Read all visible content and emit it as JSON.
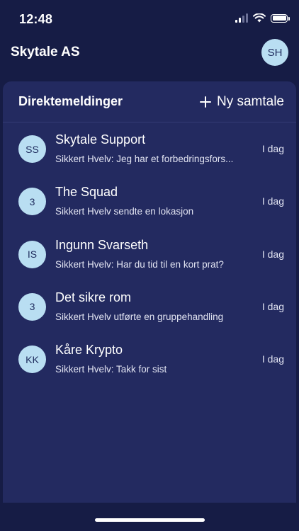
{
  "status_bar": {
    "time": "12:48"
  },
  "header": {
    "org_name": "Skytale AS",
    "user_initials": "SH"
  },
  "panel": {
    "title": "Direktemeldinger",
    "new_chat_label": "Ny samtale"
  },
  "conversations": [
    {
      "initials": "SS",
      "name": "Skytale Support",
      "preview": "Sikkert Hvelv: Jeg har et forbedringsfors...",
      "date": "I dag"
    },
    {
      "initials": "3",
      "name": "The Squad",
      "preview": "Sikkert Hvelv sendte en lokasjon",
      "date": "I dag"
    },
    {
      "initials": "IS",
      "name": "Ingunn Svarseth",
      "preview": "Sikkert Hvelv: Har du tid til en kort prat?",
      "date": "I dag"
    },
    {
      "initials": "3",
      "name": "Det sikre rom",
      "preview": "Sikkert Hvelv utførte en gruppehandling",
      "date": "I dag"
    },
    {
      "initials": "KK",
      "name": "Kåre Krypto",
      "preview": "Sikkert Hvelv: Takk for sist",
      "date": "I dag"
    }
  ],
  "colors": {
    "background": "#161c45",
    "panel": "#232a60",
    "avatar_bg": "#b9def2",
    "avatar_text": "#1d2a5c"
  }
}
